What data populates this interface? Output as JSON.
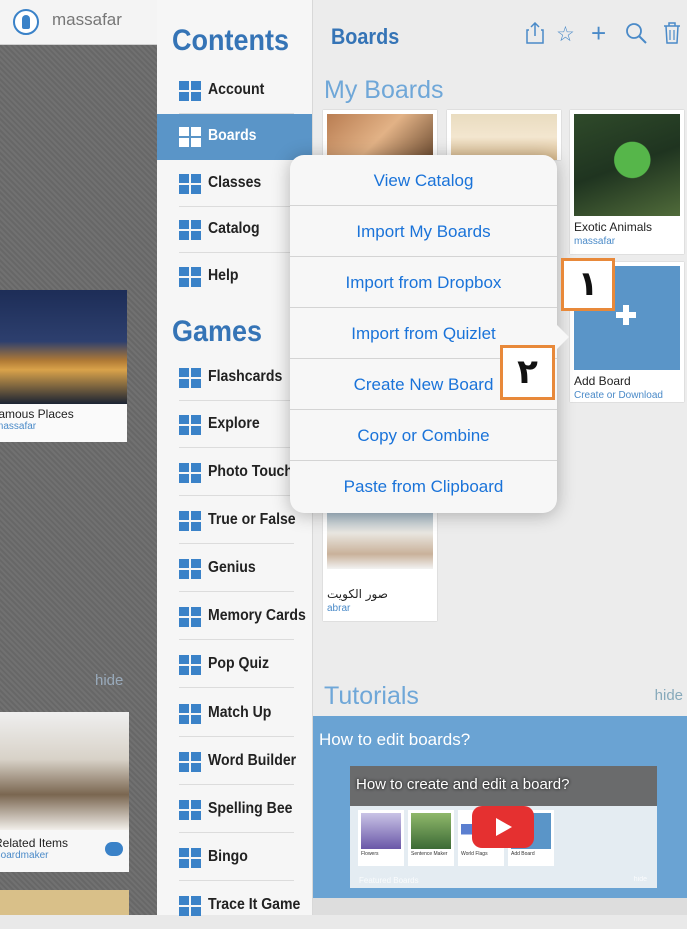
{
  "user": {
    "name": "massafar"
  },
  "left_tiles": {
    "famous": {
      "title": "Famous Places",
      "owner": "massafar"
    },
    "hide": "hide",
    "related": {
      "title": "Related Items",
      "owner": "Boardmaker"
    }
  },
  "contents": {
    "title": "Contents",
    "items": [
      {
        "label": "Account"
      },
      {
        "label": "Boards"
      },
      {
        "label": "Classes"
      },
      {
        "label": "Catalog"
      },
      {
        "label": "Help"
      }
    ],
    "games_title": "Games",
    "games": [
      {
        "label": "Flashcards"
      },
      {
        "label": "Explore"
      },
      {
        "label": "Photo Touch"
      },
      {
        "label": "True or False"
      },
      {
        "label": "Genius"
      },
      {
        "label": "Memory Cards"
      },
      {
        "label": "Pop Quiz"
      },
      {
        "label": "Match Up"
      },
      {
        "label": "Word Builder"
      },
      {
        "label": "Spelling Bee"
      },
      {
        "label": "Bingo"
      },
      {
        "label": "Trace It Game"
      }
    ]
  },
  "boards": {
    "title": "Boards",
    "my_boards_title": "My Boards",
    "tiles": [
      {
        "title": "Exotic Animals",
        "owner": "massafar"
      },
      {
        "title": "Add Board",
        "owner": "Create or Download"
      },
      {
        "title": "صور الكويت",
        "owner": "abrar"
      }
    ],
    "tutorials_title": "Tutorials",
    "tutorials_hide": "hide",
    "tutorial_question": "How to edit boards?",
    "video_title": "How to create and edit a board?",
    "video_cards": [
      "Flowers",
      "Sentence Maker",
      "World Flags",
      "Add Board"
    ],
    "video_featured": "Featured Boards",
    "video_hide": "hide"
  },
  "menu": {
    "items": [
      "View Catalog",
      "Import My Boards",
      "Import from Dropbox",
      "Import from Quizlet",
      "Create New Board",
      "Copy or Combine",
      "Paste from Clipboard"
    ]
  },
  "callouts": [
    "١",
    "٢"
  ],
  "colors": {
    "accent": "#3574b6",
    "active_nav": "#5a95c8",
    "callout_border": "#e8893a",
    "menu_text": "#1a73d9"
  }
}
